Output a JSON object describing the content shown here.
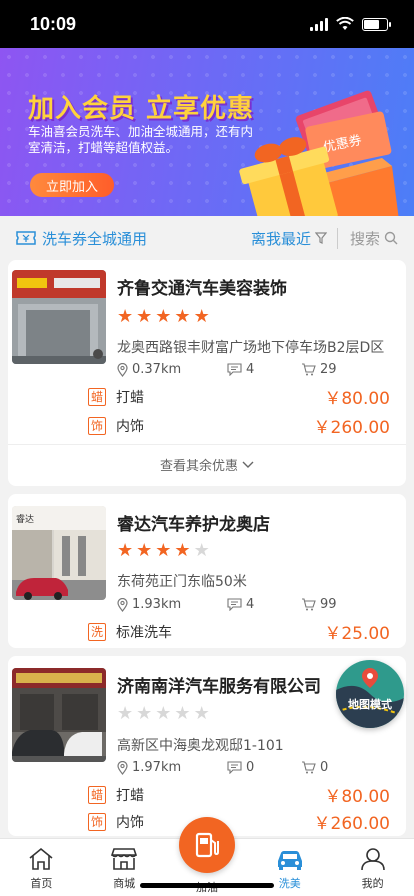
{
  "status": {
    "time": "10:09"
  },
  "banner": {
    "title": "加入会员 立享优惠",
    "text": "车油喜会员洗车、加油全城通用，还有内室清洁，打蜡等超值权益。",
    "button": "立即加入",
    "ticket_label": "优惠券"
  },
  "filter": {
    "coupon": "洗车券全城通用",
    "sort": "离我最近",
    "search": "搜索"
  },
  "shops": [
    {
      "name": "齐鲁交通汽车美容装饰",
      "rating": 5,
      "address": "龙奥西路银丰财富广场地下停车场B2层D区",
      "distance": "0.37km",
      "comments": "4",
      "orders": "29",
      "services": [
        {
          "badge": "蜡",
          "name": "打蜡",
          "price": "￥80.00"
        },
        {
          "badge": "饰",
          "name": "内饰",
          "price": "￥260.00"
        }
      ],
      "more": "查看其余优惠"
    },
    {
      "name": "睿达汽车养护龙奥店",
      "rating": 4,
      "address": "东荷苑正门东临50米",
      "distance": "1.93km",
      "comments": "4",
      "orders": "99",
      "services": [
        {
          "badge": "洗",
          "name": "标准洗车",
          "price": "￥25.00"
        }
      ]
    },
    {
      "name": "济南南洋汽车服务有限公司",
      "rating": 0,
      "address": "高新区中海奥龙观邸1-101",
      "distance": "1.97km",
      "comments": "0",
      "orders": "0",
      "services": [
        {
          "badge": "蜡",
          "name": "打蜡",
          "price": "￥80.00"
        },
        {
          "badge": "饰",
          "name": "内饰",
          "price": "￥260.00"
        }
      ]
    }
  ],
  "map_mode": "地图模式",
  "tabs": [
    {
      "label": "首页",
      "icon": "home-icon"
    },
    {
      "label": "商城",
      "icon": "shop-icon"
    },
    {
      "label": "加油",
      "icon": "fuel-icon"
    },
    {
      "label": "洗美",
      "icon": "car-icon",
      "active": true
    },
    {
      "label": "我的",
      "icon": "user-icon"
    }
  ],
  "colors": {
    "accent": "#f26522",
    "primary": "#2a8fd8"
  }
}
